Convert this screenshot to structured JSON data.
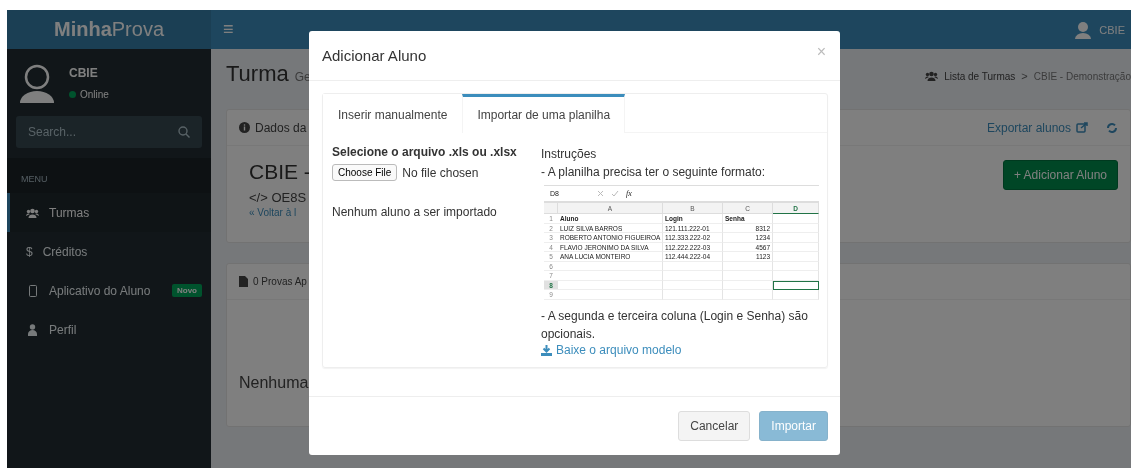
{
  "brand": {
    "bold": "Minha",
    "light": "Prova"
  },
  "header": {
    "menu": "≡",
    "user": "CBIE"
  },
  "sidebar": {
    "user": {
      "name": "CBIE",
      "status": "Online"
    },
    "search": {
      "placeholder": "Search..."
    },
    "menu_label": "MENU",
    "items": [
      {
        "label": "Turmas",
        "kind": "users",
        "selected": true
      },
      {
        "label": "Créditos",
        "kind": "dollar",
        "glyph": "$",
        "selected": false
      },
      {
        "label": "Aplicativo do Aluno",
        "kind": "mobile",
        "selected": false,
        "badge": "Novo"
      },
      {
        "label": "Perfil",
        "kind": "user",
        "selected": false
      }
    ]
  },
  "page": {
    "title": "Turma",
    "subtitle": "Ge",
    "breadcrumb": [
      "Lista de Turmas",
      "CBIE - Demonstração"
    ],
    "breadcrumb_separator": ">",
    "class_box": {
      "header": "Dados da",
      "export": "Exportar alunos",
      "name": "CBIE -",
      "code": "</> OE8S",
      "back_link": "« Voltar à l",
      "add_button_icon": "+",
      "add_button": "Adicionar Aluno"
    },
    "exams_box": {
      "header": "0 Provas Ap",
      "empty": "Nenhuma"
    }
  },
  "modal": {
    "title": "Adicionar Aluno",
    "close": "×",
    "tabs": [
      {
        "label": "Inserir manualmente",
        "selected": false
      },
      {
        "label": "Importar de uma planilha",
        "selected": true
      }
    ],
    "file": {
      "label": "Selecione o arquivo .xls ou .xlsx",
      "button": "Choose File",
      "status": "No file chosen"
    },
    "import_status": "Nenhum aluno a ser importado",
    "instructions": {
      "title": "Instruções",
      "line1": "- A planilha precisa ter o seguinte formato:",
      "note": "- A segunda e terceira coluna (Login e Senha) são opcionais.",
      "download": "Baixe o arquivo modelo"
    },
    "sheet": {
      "cell_ref": "D8",
      "formula": "fx",
      "columns": [
        {
          "label": "A",
          "selected": false
        },
        {
          "label": "B",
          "selected": false
        },
        {
          "label": "C",
          "selected": false
        },
        {
          "label": "D",
          "selected": true
        }
      ],
      "rows": [
        {
          "num": "1",
          "kind": "header",
          "selected": false,
          "aluno": "Aluno",
          "login": "Login",
          "senha": "Senha"
        },
        {
          "num": "2",
          "kind": "data",
          "selected": false,
          "aluno": "LUIZ SILVA BARROS",
          "login": "121.111.222-01",
          "senha": "8312"
        },
        {
          "num": "3",
          "kind": "data",
          "selected": false,
          "aluno": "ROBERTO ANTONIO FIGUEIROA",
          "login": "112.333.222-02",
          "senha": "1234"
        },
        {
          "num": "4",
          "kind": "data",
          "selected": false,
          "aluno": "FLAVIO JERONIMO DA SILVA",
          "login": "112.222.222-03",
          "senha": "4567"
        },
        {
          "num": "5",
          "kind": "data",
          "selected": false,
          "aluno": "ANA LUCIA MONTEIRO",
          "login": "112.444.222-04",
          "senha": "1123"
        },
        {
          "num": "6",
          "kind": "empty",
          "selected": false
        },
        {
          "num": "7",
          "kind": "empty",
          "selected": false
        },
        {
          "num": "8",
          "kind": "empty",
          "selected": true
        },
        {
          "num": "9",
          "kind": "empty",
          "selected": false
        }
      ]
    },
    "buttons": [
      {
        "label": "Cancelar",
        "kind": "default",
        "disabled": false
      },
      {
        "label": "Importar",
        "kind": "primary",
        "disabled": true
      }
    ]
  }
}
